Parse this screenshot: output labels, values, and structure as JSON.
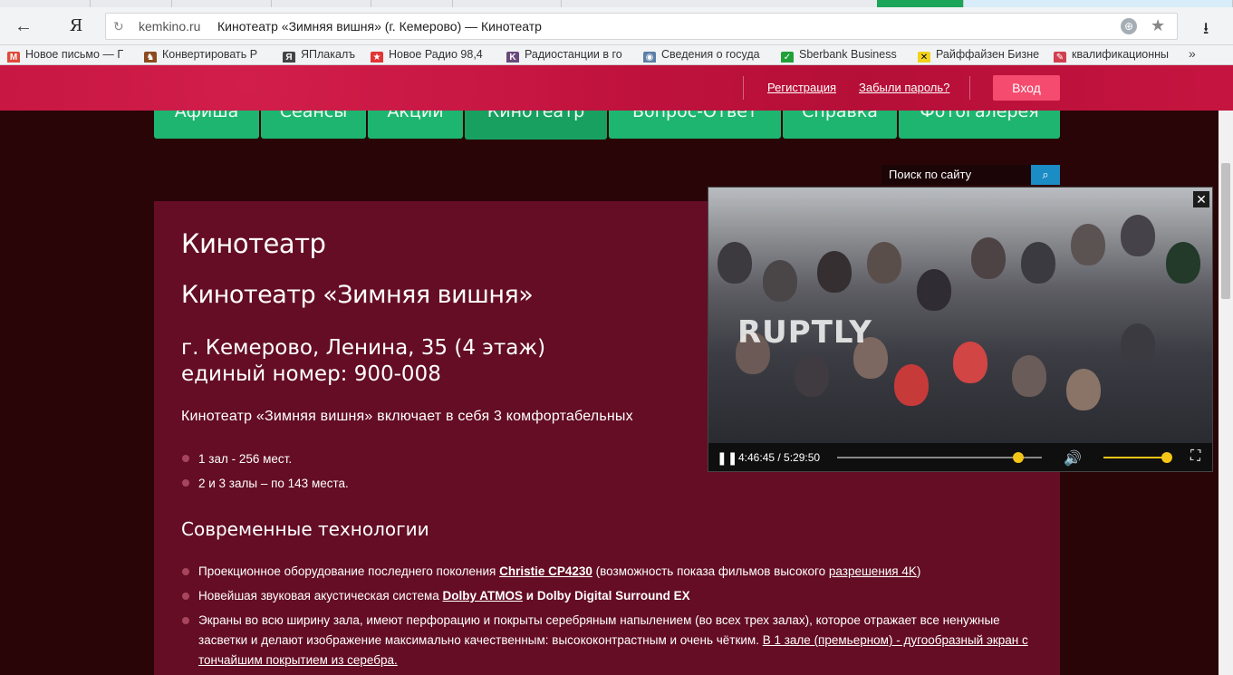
{
  "browser": {
    "tabs_strip": [
      {
        "state": "normal"
      },
      {
        "state": "normal"
      },
      {
        "state": "normal"
      },
      {
        "state": "normal"
      },
      {
        "state": "normal"
      },
      {
        "state": "normal"
      },
      {
        "state": "normal"
      },
      {
        "state": "active-green"
      },
      {
        "state": "active-blue"
      }
    ],
    "nav": {
      "back_icon": "arrow-left-icon",
      "yandex_logo": "Я",
      "reload_icon": "reload-icon"
    },
    "omnibox": {
      "host": "kemkino.ru",
      "title": "Кинотеатр «Зимняя вишня» (г. Кемерово) — Кинотеатр",
      "globe_icon": "globe-icon",
      "star_icon": "star-icon"
    },
    "download_icon": "download-icon",
    "bookmarks": [
      {
        "label": "Новое письмо — Г",
        "icon": "mail-icon",
        "color": "#e04a3a",
        "glyph": "M"
      },
      {
        "label": "Конвертировать Р",
        "icon": "convert-icon",
        "color": "#8b4b1f",
        "glyph": "♞"
      },
      {
        "label": "ЯПлакалъ",
        "icon": "yaplakal-icon",
        "color": "#444444",
        "glyph": "Я"
      },
      {
        "label": "Новое Радио 98,4",
        "icon": "radio-star-icon",
        "color": "#e23535",
        "glyph": "★"
      },
      {
        "label": "Радиостанции в го",
        "icon": "radio-icon",
        "color": "#6a4a7a",
        "glyph": "K"
      },
      {
        "label": "Сведения о госуда",
        "icon": "gov-icon",
        "color": "#5b7fa6",
        "glyph": "◉"
      },
      {
        "label": "Sberbank Business",
        "icon": "sberbank-icon",
        "color": "#21a038",
        "glyph": "✓"
      },
      {
        "label": "Райффайзен Бизне",
        "icon": "raiffeisen-icon",
        "color": "#f2d21c",
        "glyph": "✕"
      },
      {
        "label": "квалификационны",
        "icon": "qualification-icon",
        "color": "#d04050",
        "glyph": "✎"
      }
    ],
    "bookmarks_more": "»"
  },
  "header": {
    "register": "Регистрация",
    "forgot": "Забыли пароль?",
    "login": "Вход"
  },
  "nav": {
    "items": [
      {
        "label": "Афиша"
      },
      {
        "label": "Сеансы"
      },
      {
        "label": "Акции"
      },
      {
        "label": "Кинотеатр",
        "active": true
      },
      {
        "label": "Вопрос-Ответ"
      },
      {
        "label": "Справка"
      },
      {
        "label": "Фотогалерея"
      }
    ]
  },
  "search": {
    "placeholder": "Поиск по сайту",
    "icon": "search-icon"
  },
  "content": {
    "page_title": "Кинотеатр",
    "cinema_name": "Кинотеатр «Зимняя вишня»",
    "address": "г. Кемерово, Ленина, 35 (4 этаж)",
    "phone": "единый номер: 900-008",
    "intro": "Кинотеатр «Зимняя вишня» включает в себя 3 комфортабельных",
    "halls": [
      "1 зал - 256 мест.",
      "2 и 3 залы – по 143 места."
    ],
    "tech_heading": "Современные технологии",
    "tech": {
      "item1": {
        "pre": "Проекционное оборудование последнего поколения ",
        "link": "Christie CP4230",
        "mid": " (возможность показа фильмов высокого ",
        "link2": "разрешения 4K",
        "post": ")"
      },
      "item2": {
        "pre": "Новейшая звуковая акустическая система ",
        "link": "Dolby ATMOS",
        "post": " и Dolby Digital Surround EX"
      },
      "item3": {
        "pre": "Экраны во всю ширину зала, имеют перфорацию и покрыты серебряным напылением (во всех  трех залах), которое отражает все ненужные засветки и делают изображение максимально качественным: высококонтрастным и очень чётким. ",
        "link": "В 1 зале (премьерном) - дугообразный экран с тончайшим покрытием из серебра."
      }
    }
  },
  "video": {
    "watermark": "RUPTLY",
    "close": "✕",
    "time_current": "4:46:45",
    "time_total": "5:29:50",
    "time_display": "4:46:45 / 5:29:50",
    "progress": 0.885,
    "volume": 1.0,
    "play_icon": "pause-icon",
    "volume_icon": "volume-icon",
    "fullscreen_icon": "fullscreen-icon"
  }
}
